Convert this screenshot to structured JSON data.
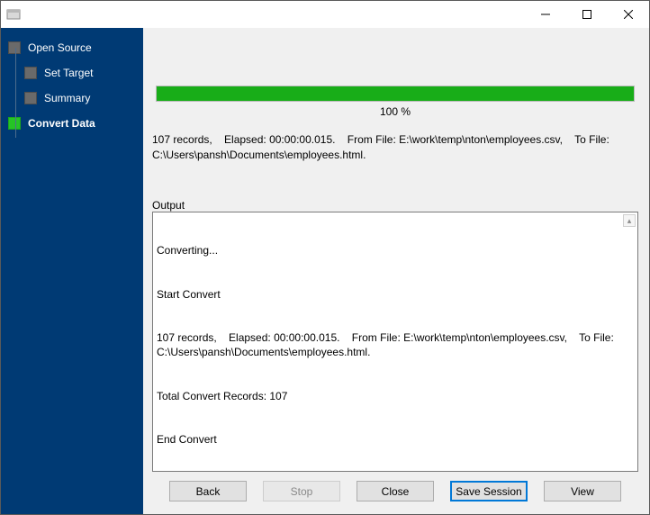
{
  "window": {
    "title": ""
  },
  "sidebar": {
    "steps": [
      {
        "label": "Open Source",
        "active": false,
        "indent": false
      },
      {
        "label": "Set Target",
        "active": false,
        "indent": true
      },
      {
        "label": "Summary",
        "active": false,
        "indent": true
      },
      {
        "label": "Convert Data",
        "active": true,
        "indent": false
      }
    ]
  },
  "progress": {
    "percent": 100,
    "percent_text": "100 %"
  },
  "summary_text": "107 records,    Elapsed: 00:00:00.015.    From File: E:\\work\\temp\\nton\\employees.csv,    To File: C:\\Users\\pansh\\Documents\\employees.html.",
  "output_label": "Output",
  "output_lines": [
    "Converting...",
    "Start Convert",
    "107 records,    Elapsed: 00:00:00.015.    From File: E:\\work\\temp\\nton\\employees.csv,    To File: C:\\Users\\pansh\\Documents\\employees.html.",
    "Total Convert Records: 107",
    "End Convert"
  ],
  "buttons": {
    "back": "Back",
    "stop": "Stop",
    "close": "Close",
    "save_session": "Save Session",
    "view": "View"
  }
}
